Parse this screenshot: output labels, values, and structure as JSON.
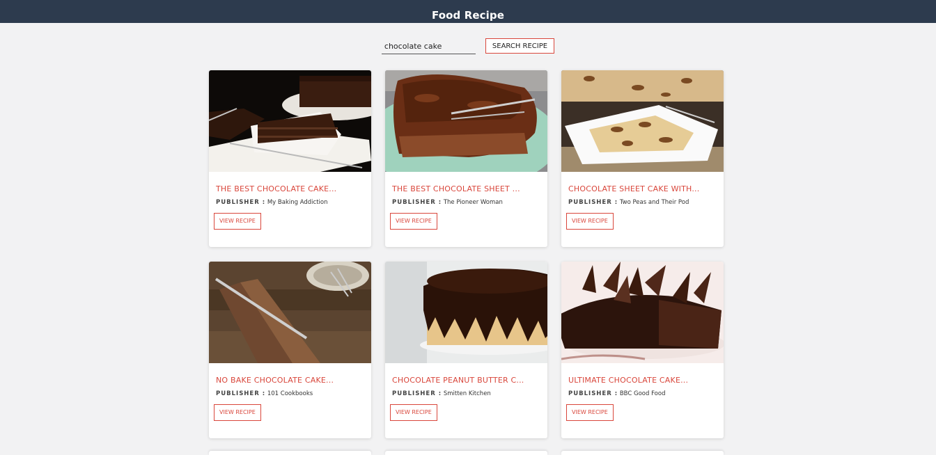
{
  "header": {
    "title": "Food Recipe"
  },
  "search": {
    "value": "chocolate cake",
    "button_label": "SEARCH RECIPE"
  },
  "publisher_label": "PUBLISHER :",
  "view_button_label": "VIEW RECIPE",
  "recipes": [
    {
      "title": "THE BEST CHOCOLATE CAKE...",
      "publisher": "My Baking Addiction"
    },
    {
      "title": "THE BEST CHOCOLATE SHEET ...",
      "publisher": "The Pioneer Woman"
    },
    {
      "title": "CHOCOLATE SHEET CAKE WITH...",
      "publisher": "Two Peas and Their Pod"
    },
    {
      "title": "NO BAKE CHOCOLATE CAKE...",
      "publisher": "101 Cookbooks"
    },
    {
      "title": "CHOCOLATE PEANUT BUTTER C...",
      "publisher": "Smitten Kitchen"
    },
    {
      "title": "ULTIMATE CHOCOLATE CAKE...",
      "publisher": "BBC Good Food"
    }
  ],
  "colors": {
    "header_bg": "#2d3b4e",
    "accent": "#d9463b",
    "page_bg": "#f2f2f3"
  }
}
